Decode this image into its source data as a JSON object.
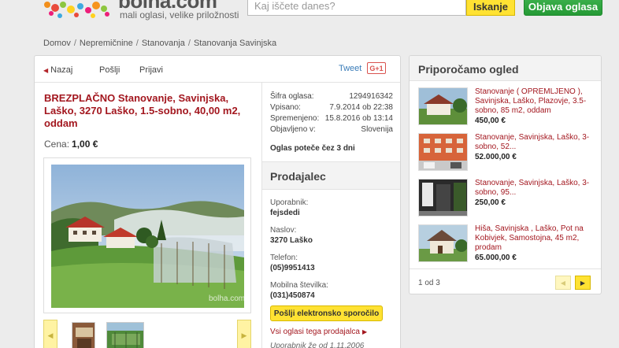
{
  "header": {
    "logo_text": "bolha.com",
    "tagline": "mali oglasi, velike priložnosti",
    "search_placeholder": "Kaj iščete danes?",
    "search_button": "Iskanje",
    "post_button": "Objava oglasa"
  },
  "breadcrumb": [
    "Domov",
    "Nepremičnine",
    "Stanovanja",
    "Stanovanja Savinjska"
  ],
  "toolbar": {
    "back": "Nazaj",
    "send": "Pošlji",
    "report": "Prijavi",
    "tweet": "Tweet",
    "gplus": "G+1"
  },
  "listing": {
    "title": "BREZPLAČNO Stanovanje, Savinjska, Laško, 3270 Laško, 1.5-sobno, 40,00 m2, oddam",
    "price_label": "Cena:",
    "price_value": "1,00 €",
    "watermark": "bolha.com"
  },
  "meta": {
    "rows": [
      {
        "label": "Šifra oglasa:",
        "value": "1294916342"
      },
      {
        "label": "Vpisano:",
        "value": "7.9.2014 ob 22:38"
      },
      {
        "label": "Spremenjeno:",
        "value": "15.8.2016 ob 13:14"
      },
      {
        "label": "Objavljeno v:",
        "value": "Slovenija"
      }
    ],
    "expiry": "Oglas poteče čez 3 dni"
  },
  "seller": {
    "heading": "Prodajalec",
    "user_label": "Uporabnik:",
    "user_value": "fejsdedi",
    "address_label": "Naslov:",
    "address_value": "3270 Laško",
    "phone_label": "Telefon:",
    "phone_value": "(05)9951413",
    "mobile_label": "Mobilna številka:",
    "mobile_value": "(031)450874",
    "message_button": "Pošlji elektronsko sporočilo",
    "all_ads_link": "Vsi oglasi tega prodajalca",
    "since": "Uporabnik že od 1.11.2006"
  },
  "recommended": {
    "heading": "Priporočamo ogled",
    "items": [
      {
        "title": "Stanovanje ( OPREMLJENO ), Savinjska, Laško, Plazovje, 3.5-sobno, 85 m2, oddam",
        "price": "450,00 €"
      },
      {
        "title": "Stanovanje, Savinjska, Laško, 3-sobno, 52...",
        "price": "52.000,00 €"
      },
      {
        "title": "Stanovanje, Savinjska, Laško, 3-sobno, 95...",
        "price": "250,00 €"
      },
      {
        "title": "Hiša, Savinjska , Laško, Pot na Kobivjek, Samostojna, 45 m2, prodam",
        "price": "65.000,00 €"
      }
    ],
    "pagination": "1 od 3"
  },
  "colors": {
    "accent_red": "#a3171f",
    "button_yellow": "#ffe233",
    "button_green": "#2ea63f"
  }
}
